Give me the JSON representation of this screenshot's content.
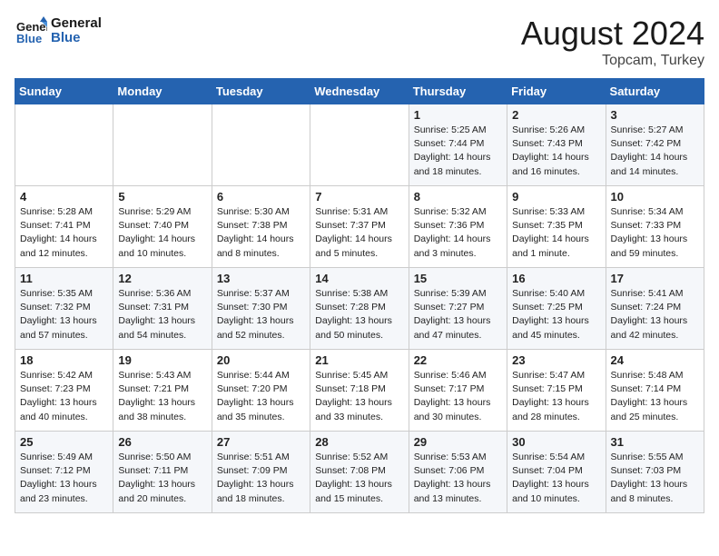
{
  "header": {
    "logo_line1": "General",
    "logo_line2": "Blue",
    "title": "August 2024",
    "subtitle": "Topcam, Turkey"
  },
  "days_of_week": [
    "Sunday",
    "Monday",
    "Tuesday",
    "Wednesday",
    "Thursday",
    "Friday",
    "Saturday"
  ],
  "weeks": [
    [
      {
        "day": "",
        "info": ""
      },
      {
        "day": "",
        "info": ""
      },
      {
        "day": "",
        "info": ""
      },
      {
        "day": "",
        "info": ""
      },
      {
        "day": "1",
        "info": "Sunrise: 5:25 AM\nSunset: 7:44 PM\nDaylight: 14 hours\nand 18 minutes."
      },
      {
        "day": "2",
        "info": "Sunrise: 5:26 AM\nSunset: 7:43 PM\nDaylight: 14 hours\nand 16 minutes."
      },
      {
        "day": "3",
        "info": "Sunrise: 5:27 AM\nSunset: 7:42 PM\nDaylight: 14 hours\nand 14 minutes."
      }
    ],
    [
      {
        "day": "4",
        "info": "Sunrise: 5:28 AM\nSunset: 7:41 PM\nDaylight: 14 hours\nand 12 minutes."
      },
      {
        "day": "5",
        "info": "Sunrise: 5:29 AM\nSunset: 7:40 PM\nDaylight: 14 hours\nand 10 minutes."
      },
      {
        "day": "6",
        "info": "Sunrise: 5:30 AM\nSunset: 7:38 PM\nDaylight: 14 hours\nand 8 minutes."
      },
      {
        "day": "7",
        "info": "Sunrise: 5:31 AM\nSunset: 7:37 PM\nDaylight: 14 hours\nand 5 minutes."
      },
      {
        "day": "8",
        "info": "Sunrise: 5:32 AM\nSunset: 7:36 PM\nDaylight: 14 hours\nand 3 minutes."
      },
      {
        "day": "9",
        "info": "Sunrise: 5:33 AM\nSunset: 7:35 PM\nDaylight: 14 hours\nand 1 minute."
      },
      {
        "day": "10",
        "info": "Sunrise: 5:34 AM\nSunset: 7:33 PM\nDaylight: 13 hours\nand 59 minutes."
      }
    ],
    [
      {
        "day": "11",
        "info": "Sunrise: 5:35 AM\nSunset: 7:32 PM\nDaylight: 13 hours\nand 57 minutes."
      },
      {
        "day": "12",
        "info": "Sunrise: 5:36 AM\nSunset: 7:31 PM\nDaylight: 13 hours\nand 54 minutes."
      },
      {
        "day": "13",
        "info": "Sunrise: 5:37 AM\nSunset: 7:30 PM\nDaylight: 13 hours\nand 52 minutes."
      },
      {
        "day": "14",
        "info": "Sunrise: 5:38 AM\nSunset: 7:28 PM\nDaylight: 13 hours\nand 50 minutes."
      },
      {
        "day": "15",
        "info": "Sunrise: 5:39 AM\nSunset: 7:27 PM\nDaylight: 13 hours\nand 47 minutes."
      },
      {
        "day": "16",
        "info": "Sunrise: 5:40 AM\nSunset: 7:25 PM\nDaylight: 13 hours\nand 45 minutes."
      },
      {
        "day": "17",
        "info": "Sunrise: 5:41 AM\nSunset: 7:24 PM\nDaylight: 13 hours\nand 42 minutes."
      }
    ],
    [
      {
        "day": "18",
        "info": "Sunrise: 5:42 AM\nSunset: 7:23 PM\nDaylight: 13 hours\nand 40 minutes."
      },
      {
        "day": "19",
        "info": "Sunrise: 5:43 AM\nSunset: 7:21 PM\nDaylight: 13 hours\nand 38 minutes."
      },
      {
        "day": "20",
        "info": "Sunrise: 5:44 AM\nSunset: 7:20 PM\nDaylight: 13 hours\nand 35 minutes."
      },
      {
        "day": "21",
        "info": "Sunrise: 5:45 AM\nSunset: 7:18 PM\nDaylight: 13 hours\nand 33 minutes."
      },
      {
        "day": "22",
        "info": "Sunrise: 5:46 AM\nSunset: 7:17 PM\nDaylight: 13 hours\nand 30 minutes."
      },
      {
        "day": "23",
        "info": "Sunrise: 5:47 AM\nSunset: 7:15 PM\nDaylight: 13 hours\nand 28 minutes."
      },
      {
        "day": "24",
        "info": "Sunrise: 5:48 AM\nSunset: 7:14 PM\nDaylight: 13 hours\nand 25 minutes."
      }
    ],
    [
      {
        "day": "25",
        "info": "Sunrise: 5:49 AM\nSunset: 7:12 PM\nDaylight: 13 hours\nand 23 minutes."
      },
      {
        "day": "26",
        "info": "Sunrise: 5:50 AM\nSunset: 7:11 PM\nDaylight: 13 hours\nand 20 minutes."
      },
      {
        "day": "27",
        "info": "Sunrise: 5:51 AM\nSunset: 7:09 PM\nDaylight: 13 hours\nand 18 minutes."
      },
      {
        "day": "28",
        "info": "Sunrise: 5:52 AM\nSunset: 7:08 PM\nDaylight: 13 hours\nand 15 minutes."
      },
      {
        "day": "29",
        "info": "Sunrise: 5:53 AM\nSunset: 7:06 PM\nDaylight: 13 hours\nand 13 minutes."
      },
      {
        "day": "30",
        "info": "Sunrise: 5:54 AM\nSunset: 7:04 PM\nDaylight: 13 hours\nand 10 minutes."
      },
      {
        "day": "31",
        "info": "Sunrise: 5:55 AM\nSunset: 7:03 PM\nDaylight: 13 hours\nand 8 minutes."
      }
    ]
  ]
}
